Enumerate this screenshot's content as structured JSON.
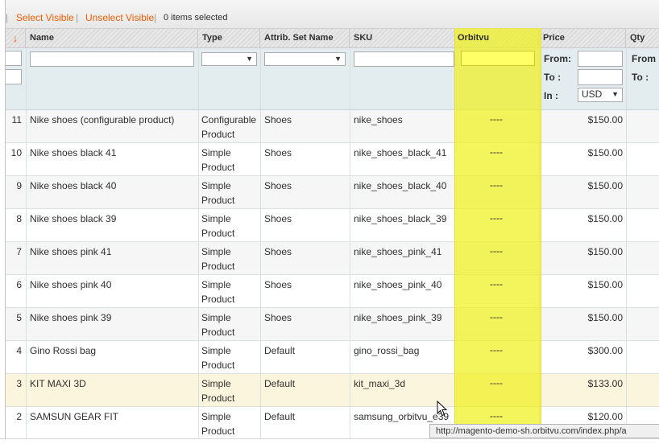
{
  "massaction": {
    "select_visible": "Select Visible",
    "unselect_visible": "Unselect Visible",
    "selected_count": "0 items selected"
  },
  "columns": {
    "name": "Name",
    "type": "Type",
    "attrib_set": "Attrib. Set Name",
    "sku": "SKU",
    "orbitvu": "Orbitvu",
    "price": "Price",
    "qty": "Qty"
  },
  "filters": {
    "price_from": "From:",
    "price_to": "To :",
    "price_in": "In :",
    "currency": "USD",
    "qty_from": "From",
    "qty_to": "To :"
  },
  "rows": [
    {
      "id": "11",
      "name": "Nike shoes (configurable product)",
      "type1": "Configurable",
      "type2": "Product",
      "set": "Shoes",
      "sku": "nike_shoes",
      "orbitvu": "----",
      "price": "$150.00"
    },
    {
      "id": "10",
      "name": "Nike shoes black 41",
      "type1": "Simple",
      "type2": "Product",
      "set": "Shoes",
      "sku": "nike_shoes_black_41",
      "orbitvu": "----",
      "price": "$150.00"
    },
    {
      "id": "9",
      "name": "Nike shoes black 40",
      "type1": "Simple",
      "type2": "Product",
      "set": "Shoes",
      "sku": "nike_shoes_black_40",
      "orbitvu": "----",
      "price": "$150.00"
    },
    {
      "id": "8",
      "name": "Nike shoes black 39",
      "type1": "Simple",
      "type2": "Product",
      "set": "Shoes",
      "sku": "nike_shoes_black_39",
      "orbitvu": "----",
      "price": "$150.00"
    },
    {
      "id": "7",
      "name": "Nike shoes pink 41",
      "type1": "Simple",
      "type2": "Product",
      "set": "Shoes",
      "sku": "nike_shoes_pink_41",
      "orbitvu": "----",
      "price": "$150.00"
    },
    {
      "id": "6",
      "name": "Nike shoes pink 40",
      "type1": "Simple",
      "type2": "Product",
      "set": "Shoes",
      "sku": "nike_shoes_pink_40",
      "orbitvu": "----",
      "price": "$150.00"
    },
    {
      "id": "5",
      "name": "Nike shoes pink 39",
      "type1": "Simple",
      "type2": "Product",
      "set": "Shoes",
      "sku": "nike_shoes_pink_39",
      "orbitvu": "----",
      "price": "$150.00"
    },
    {
      "id": "4",
      "name": "Gino Rossi bag",
      "type1": "Simple",
      "type2": "Product",
      "set": "Default",
      "sku": "gino_rossi_bag",
      "orbitvu": "----",
      "price": "$300.00"
    },
    {
      "id": "3",
      "name": "KIT MAXI 3D",
      "type1": "Simple",
      "type2": "Product",
      "set": "Default",
      "sku": "kit_maxi_3d",
      "orbitvu": "----",
      "price": "$133.00"
    },
    {
      "id": "2",
      "name": "SAMSUN GEAR FIT",
      "type1": "Simple",
      "type2": "Product",
      "set": "Default",
      "sku": "samsung_orbitvu_e39",
      "orbitvu": "----",
      "price": "$120.00"
    }
  ],
  "status_url": "http://magento-demo-sh.orbitvu.com/index.php/a",
  "colors": {
    "accent": "#eb5e00",
    "highlight": "#f0f01e",
    "filter_bg": "#e3edf0",
    "row_highlight": "#fcf5dd"
  }
}
